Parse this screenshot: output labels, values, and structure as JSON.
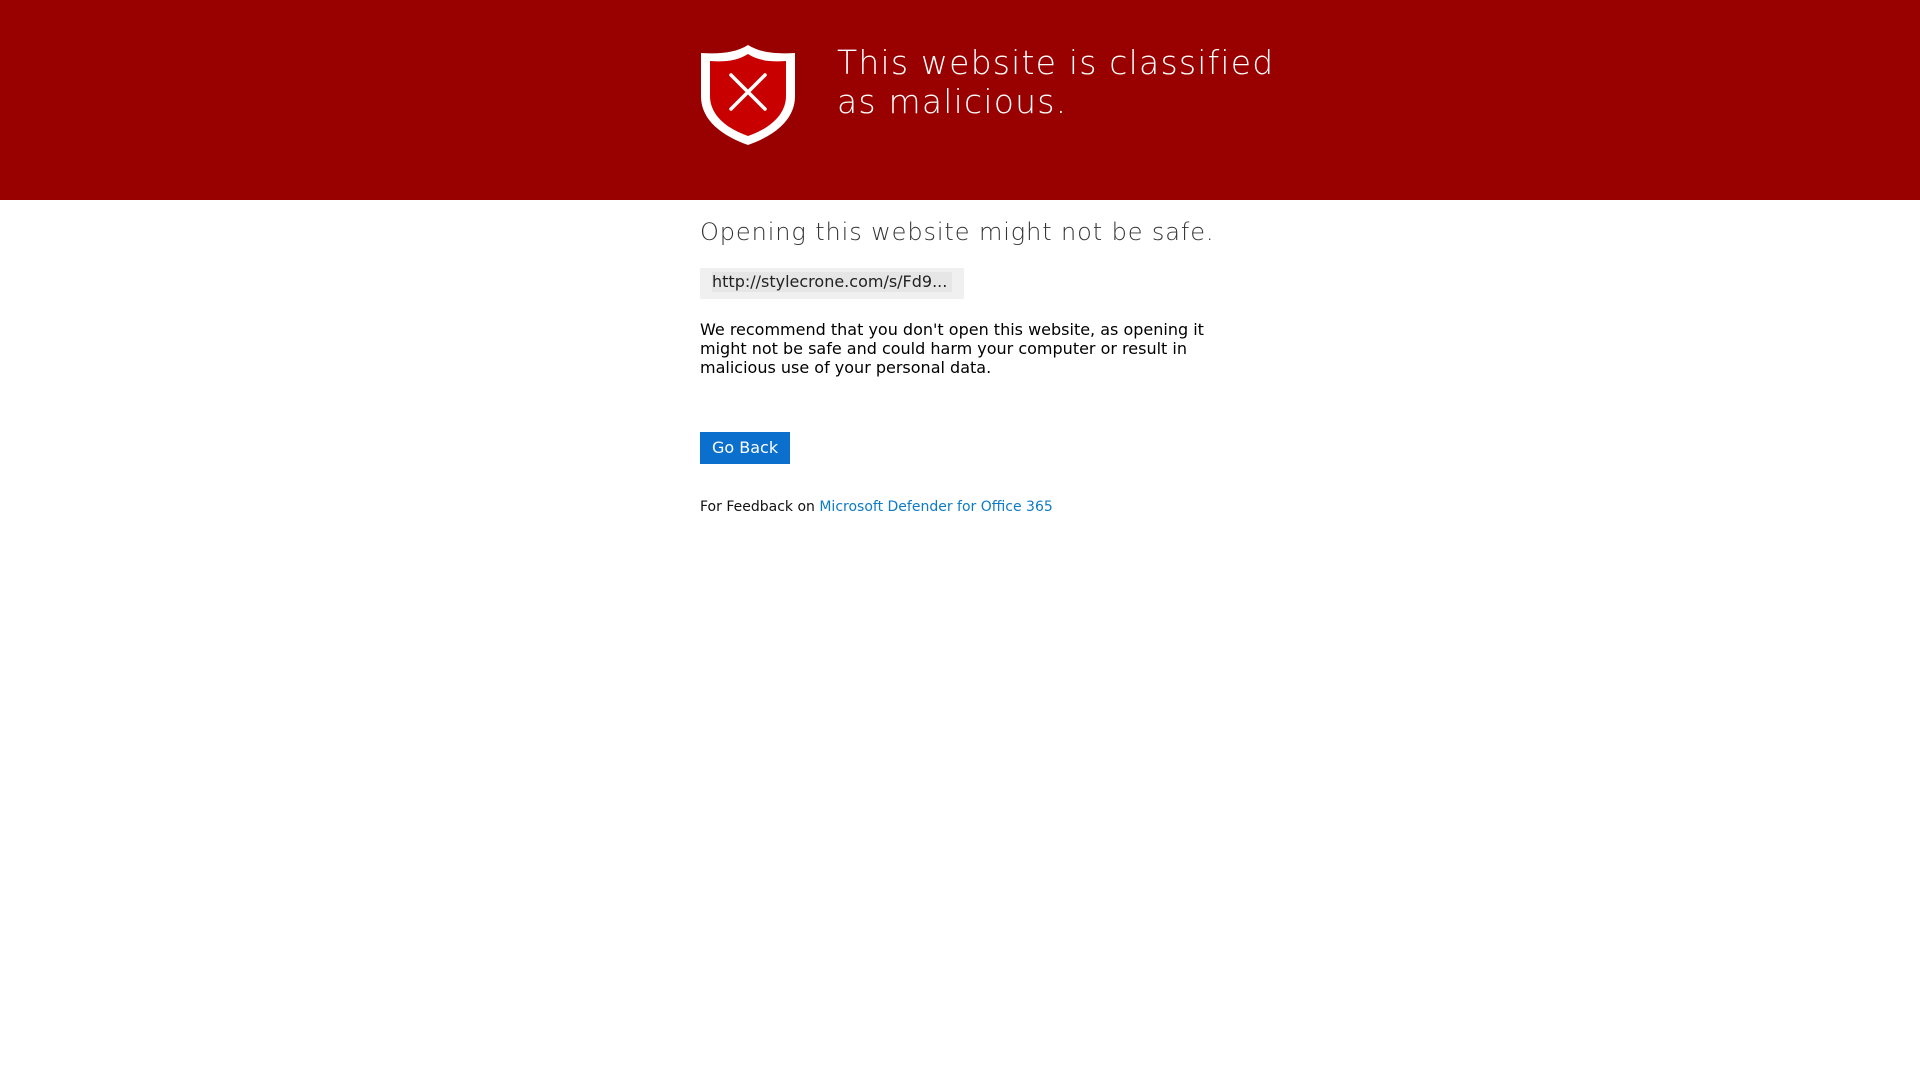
{
  "banner": {
    "title": "This website is classified as malicious.",
    "background_color": "#990000",
    "icon": "shield-x-icon"
  },
  "warning": {
    "subtitle": "Opening this website might not be safe.",
    "url": "http://stylecrone.com/s/Fd9...",
    "recommendation": "We recommend that you don't open this website, as opening it might not be safe and could harm your computer or result in malicious use of your personal data."
  },
  "actions": {
    "go_back_label": "Go Back",
    "button_color": "#0b6fce"
  },
  "feedback": {
    "prefix": "For Feedback on",
    "link_text": "Microsoft Defender for Office 365",
    "link_color": "#0f7bc4"
  }
}
